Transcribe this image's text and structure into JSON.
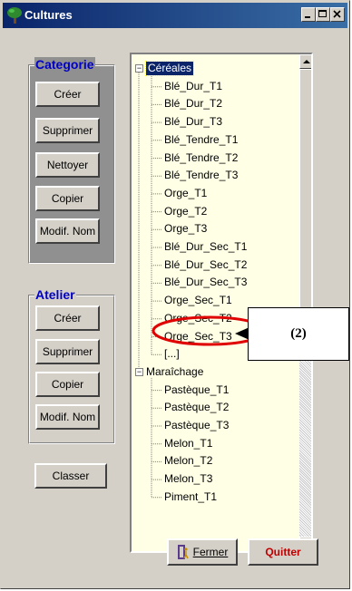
{
  "window": {
    "title": "Cultures"
  },
  "title_buttons": {
    "minimize": "minimize-icon",
    "maximize": "maximize-icon",
    "close": "close-icon"
  },
  "categorie": {
    "title": "Categorie",
    "buttons": [
      "Créer",
      "Supprimer",
      "Nettoyer",
      "Copier",
      "Modif. Nom"
    ]
  },
  "atelier": {
    "title": "Atelier",
    "buttons": [
      "Créer",
      "Supprimer",
      "Copier",
      "Modif. Nom"
    ]
  },
  "classer": {
    "label": "Classer"
  },
  "tree": {
    "groups": [
      {
        "label": "Céréales",
        "expander": "−",
        "selected": true,
        "items": [
          "Blé_Dur_T1",
          "Blé_Dur_T2",
          "Blé_Dur_T3",
          "Blé_Tendre_T1",
          "Blé_Tendre_T2",
          "Blé_Tendre_T3",
          "Orge_T1",
          "Orge_T2",
          "Orge_T3",
          "Blé_Dur_Sec_T1",
          "Blé_Dur_Sec_T2",
          "Blé_Dur_Sec_T3",
          "Orge_Sec_T1",
          "Orge_Sec_T2",
          "Orge_Sec_T3",
          "[...]"
        ]
      },
      {
        "label": "Maraîchage",
        "expander": "−",
        "selected": false,
        "items": [
          "Pastèque_T1",
          "Pastèque_T2",
          "Pastèque_T3",
          "Melon_T1",
          "Melon_T2",
          "Melon_T3",
          "Piment_T1"
        ]
      }
    ],
    "highlighted_item": "Orge_Sec_T3"
  },
  "callout": {
    "label": "(2)"
  },
  "fermer": {
    "label": "Fermer",
    "icon": "door-exit-icon"
  },
  "quitter": {
    "label": "Quitter"
  },
  "colors": {
    "title_bar": "#0a246a",
    "group_title": "#0000c8",
    "quitter_text": "#c00000",
    "highlight_ellipse": "#e00000",
    "tree_bg": "#ffffe6",
    "selection": "#0a246a"
  }
}
